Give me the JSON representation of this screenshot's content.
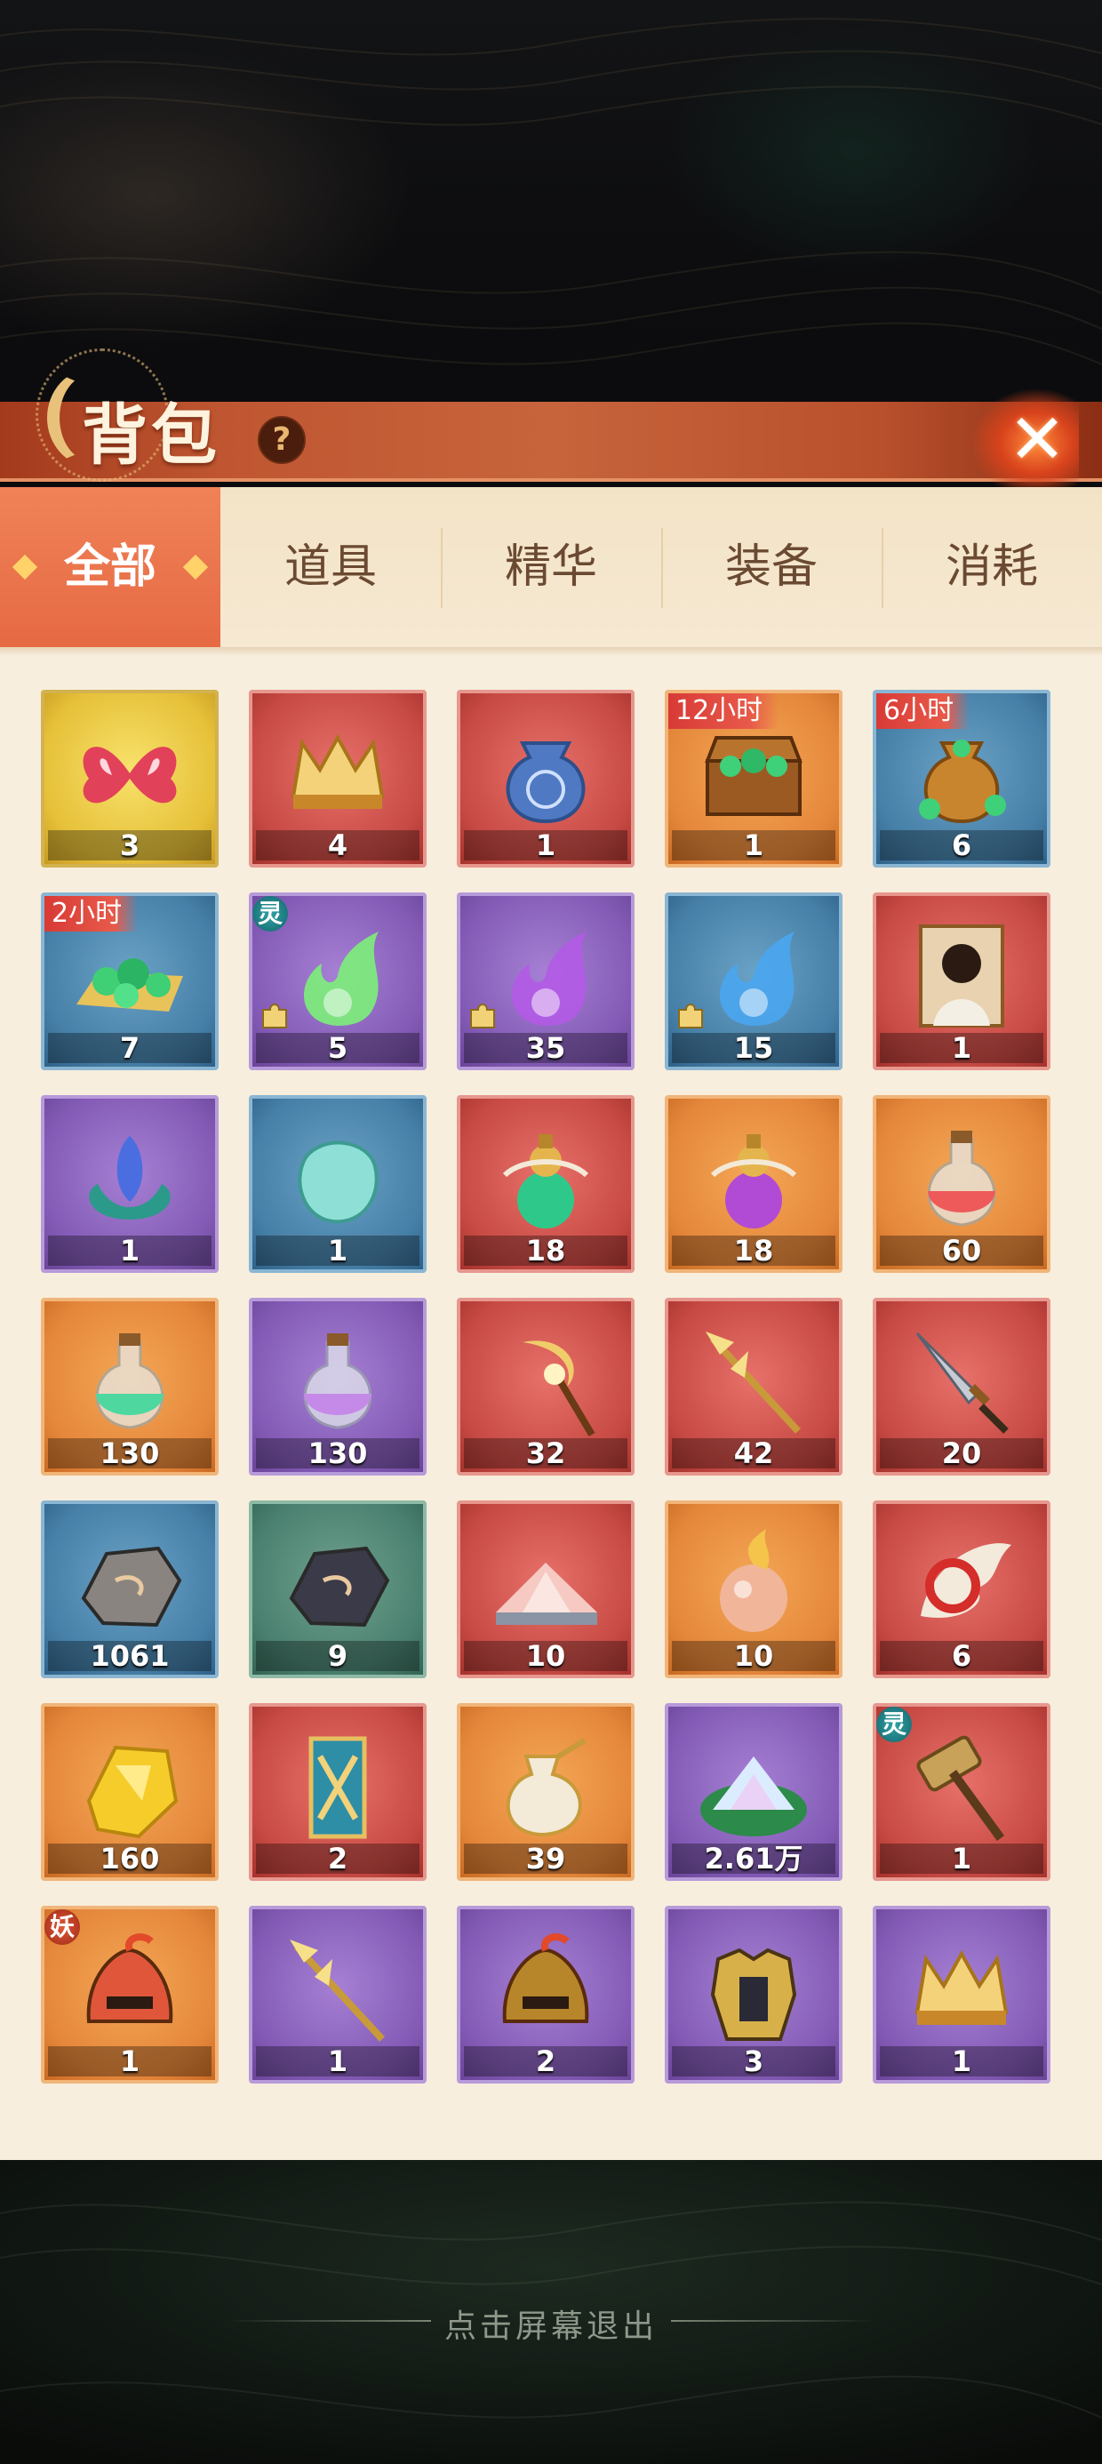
{
  "header": {
    "title": "背包",
    "help_icon": "?",
    "close_icon": "✕"
  },
  "tabs": [
    {
      "label": "全部",
      "active": true
    },
    {
      "label": "道具",
      "active": false
    },
    {
      "label": "精华",
      "active": false
    },
    {
      "label": "装备",
      "active": false
    },
    {
      "label": "消耗",
      "active": false
    }
  ],
  "items": [
    {
      "name": "butterfly-wings",
      "rarity": "gold",
      "count": "3",
      "icon": "butterfly-icon"
    },
    {
      "name": "golden-crown-chest",
      "rarity": "red",
      "count": "4",
      "icon": "crown-icon"
    },
    {
      "name": "gem-pouch",
      "rarity": "red",
      "count": "1",
      "icon": "pouch-icon"
    },
    {
      "name": "jade-treasure-chest",
      "rarity": "orange",
      "count": "1",
      "timer": "12小时",
      "icon": "chest-icon"
    },
    {
      "name": "jade-money-bag",
      "rarity": "blue",
      "count": "6",
      "timer": "6小时",
      "icon": "money-bag-icon"
    },
    {
      "name": "jade-pile",
      "rarity": "blue",
      "count": "7",
      "timer": "2小时",
      "icon": "jade-pile-icon"
    },
    {
      "name": "green-soul-flame",
      "rarity": "purple",
      "count": "5",
      "tag": "灵",
      "fragment": true,
      "icon": "flame-icon"
    },
    {
      "name": "purple-soul-flame",
      "rarity": "purple",
      "count": "35",
      "fragment": true,
      "icon": "flame-icon"
    },
    {
      "name": "blue-soul-flame",
      "rarity": "blue",
      "count": "15",
      "fragment": true,
      "icon": "flame-icon"
    },
    {
      "name": "character-portrait-card",
      "rarity": "red",
      "count": "1",
      "icon": "portrait-icon"
    },
    {
      "name": "crystal-lotus",
      "rarity": "purple",
      "count": "1",
      "icon": "lotus-icon"
    },
    {
      "name": "spirit-stone",
      "rarity": "blue",
      "count": "1",
      "icon": "stone-icon"
    },
    {
      "name": "green-elixir-gourd",
      "rarity": "red",
      "count": "18",
      "icon": "gourd-icon"
    },
    {
      "name": "purple-elixir-gourd",
      "rarity": "orange",
      "count": "18",
      "icon": "gourd-icon"
    },
    {
      "name": "red-potion",
      "rarity": "orange",
      "count": "60",
      "icon": "potion-icon"
    },
    {
      "name": "green-potion",
      "rarity": "orange",
      "count": "130",
      "icon": "potion-icon"
    },
    {
      "name": "purple-potion",
      "rarity": "purple",
      "count": "130",
      "icon": "potion-icon"
    },
    {
      "name": "golden-crescent-staff",
      "rarity": "red",
      "count": "32",
      "icon": "staff-icon"
    },
    {
      "name": "golden-spear",
      "rarity": "red",
      "count": "42",
      "icon": "spear-icon"
    },
    {
      "name": "steel-dagger",
      "rarity": "red",
      "count": "20",
      "icon": "dagger-icon"
    },
    {
      "name": "iron-ore",
      "rarity": "blue",
      "count": "1061",
      "icon": "ore-icon"
    },
    {
      "name": "dark-ore",
      "rarity": "green",
      "count": "9",
      "icon": "ore-icon"
    },
    {
      "name": "pink-salt-crystal",
      "rarity": "red",
      "count": "10",
      "icon": "crystal-icon"
    },
    {
      "name": "fire-orb",
      "rarity": "orange",
      "count": "10",
      "icon": "orb-icon"
    },
    {
      "name": "phoenix-feather",
      "rarity": "red",
      "count": "6",
      "icon": "feather-icon"
    },
    {
      "name": "gold-nugget",
      "rarity": "orange",
      "count": "160",
      "icon": "gold-icon"
    },
    {
      "name": "sword-banner",
      "rarity": "red",
      "count": "2",
      "icon": "banner-icon"
    },
    {
      "name": "golden-vase",
      "rarity": "orange",
      "count": "39",
      "icon": "vase-icon"
    },
    {
      "name": "crystal-powder-leaf",
      "rarity": "purple",
      "count": "2.61万",
      "icon": "powder-icon"
    },
    {
      "name": "war-hammer",
      "rarity": "red",
      "count": "1",
      "tag": "灵",
      "icon": "hammer-icon"
    },
    {
      "name": "flame-helmet",
      "rarity": "orange",
      "count": "1",
      "tag": "妖",
      "icon": "helmet-icon"
    },
    {
      "name": "golden-trident",
      "rarity": "purple",
      "count": "1",
      "icon": "spear-icon"
    },
    {
      "name": "red-plume-helmet",
      "rarity": "purple",
      "count": "2",
      "icon": "helmet-icon"
    },
    {
      "name": "golden-armor",
      "rarity": "purple",
      "count": "3",
      "icon": "armor-icon"
    },
    {
      "name": "violet-crown",
      "rarity": "purple",
      "count": "1",
      "icon": "crown-icon"
    }
  ],
  "footer": {
    "hint": "点击屏幕退出"
  }
}
